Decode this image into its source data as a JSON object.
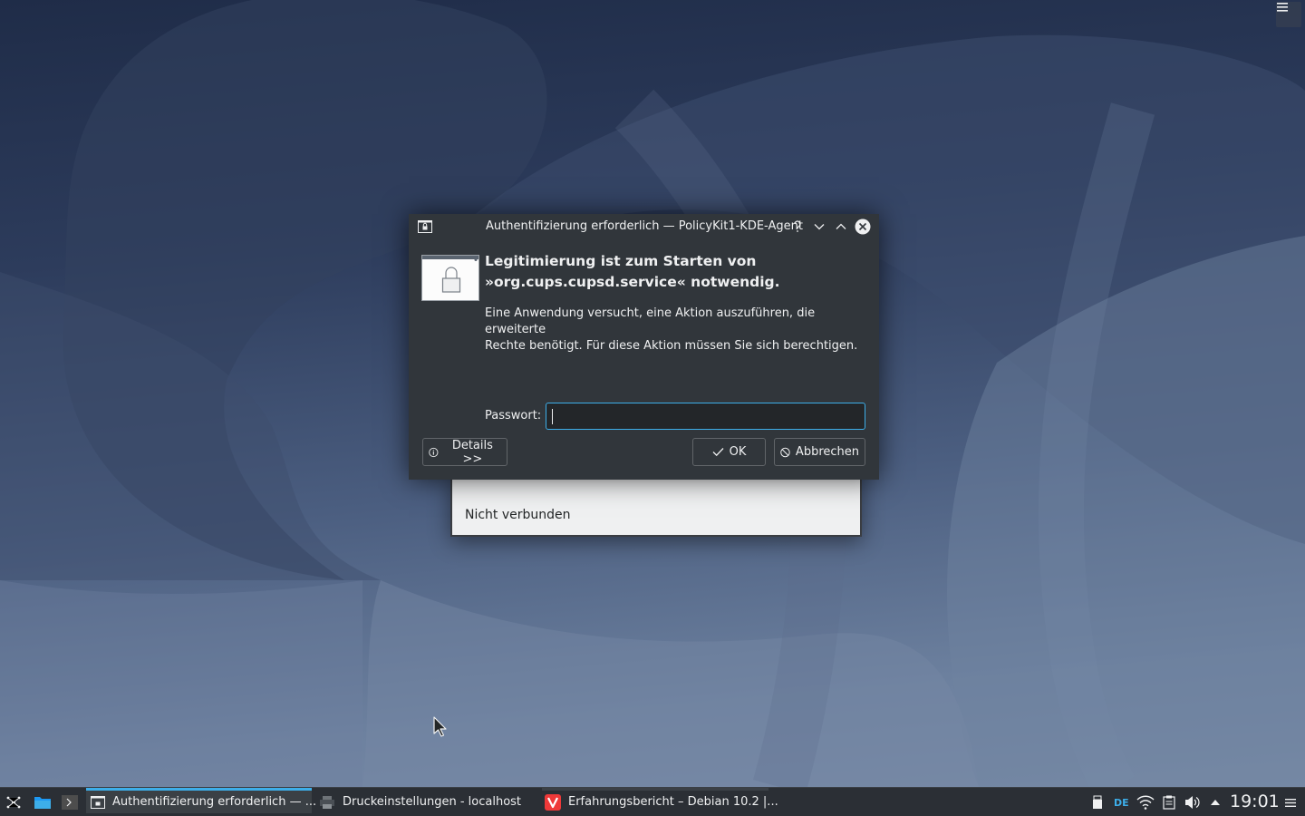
{
  "dialog": {
    "title": "Authentifizierung erforderlich — PolicyKit1-KDE-Agent",
    "heading_line1": "Legitimierung ist zum Starten von",
    "heading_line2": "»org.cups.cupsd.service« notwendig.",
    "description_line1": "Eine Anwendung versucht, eine Aktion auszuführen, die erweiterte",
    "description_line2": "Rechte benötigt. Für diese Aktion müssen Sie sich berechtigen.",
    "password_label": "Passwort:",
    "password_value": "",
    "details_label": "Details >>",
    "ok_label": "OK",
    "cancel_label": "Abbrechen"
  },
  "background_window": {
    "status_text": "Nicht verbunden"
  },
  "taskbar": {
    "tasks": [
      {
        "label": "Authentifizierung erforderlich — ...",
        "icon": "lock-window-icon"
      },
      {
        "label": "Druckeinstellungen - localhost",
        "icon": "printer-icon"
      },
      {
        "label": "Erfahrungsbericht – Debian 10.2 |...",
        "icon": "vivaldi-icon"
      }
    ],
    "keyboard_layout": "DE",
    "clock": "19:01"
  },
  "colors": {
    "accent": "#3daee9",
    "dialog_bg": "#31363b",
    "taskbar_bg": "#2b2f35"
  }
}
